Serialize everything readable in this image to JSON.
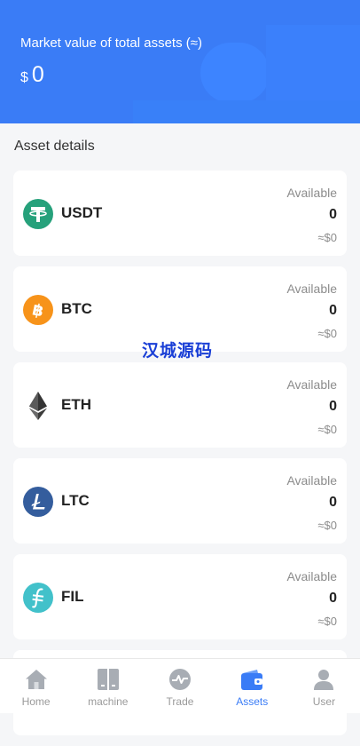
{
  "header": {
    "title": "Market value of total assets (≈)",
    "currency": "$",
    "value": "0"
  },
  "section_title": "Asset details",
  "assets": [
    {
      "name": "USDT",
      "available_label": "Available",
      "available": "0",
      "approx": "≈$0",
      "icon": "tether-icon",
      "color": "#26a17b"
    },
    {
      "name": "BTC",
      "available_label": "Available",
      "available": "0",
      "approx": "≈$0",
      "icon": "bitcoin-icon",
      "color": "#f7931a"
    },
    {
      "name": "ETH",
      "available_label": "Available",
      "available": "0",
      "approx": "≈$0",
      "icon": "ethereum-icon",
      "color": "#343434"
    },
    {
      "name": "LTC",
      "available_label": "Available",
      "available": "0",
      "approx": "≈$0",
      "icon": "litecoin-icon",
      "color": "#345d9d"
    },
    {
      "name": "FIL",
      "available_label": "Available",
      "available": "0",
      "approx": "≈$0",
      "icon": "filecoin-icon",
      "color": "#42c1ca"
    }
  ],
  "watermark": "汉城源码",
  "tabs": [
    {
      "label": "Home",
      "icon": "home-icon",
      "active": false
    },
    {
      "label": "machine",
      "icon": "machine-icon",
      "active": false
    },
    {
      "label": "Trade",
      "icon": "trade-icon",
      "active": false
    },
    {
      "label": "Assets",
      "icon": "wallet-icon",
      "active": true
    },
    {
      "label": "User",
      "icon": "user-icon",
      "active": false
    }
  ],
  "colors": {
    "accent": "#3a7cf6",
    "inactive": "#9a9a9a"
  }
}
